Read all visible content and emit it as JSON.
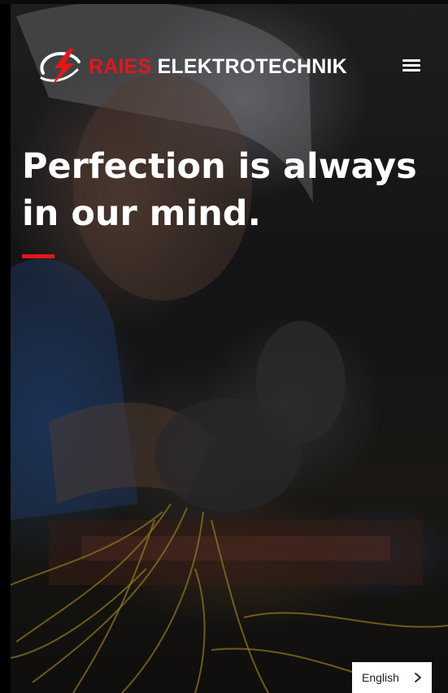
{
  "header": {
    "brand_primary": "RAIES",
    "brand_secondary": "ELEKTROTECHNIK",
    "logo_icon": "lightning-bolt-icon",
    "menu_icon": "hamburger-menu-icon"
  },
  "hero": {
    "title": "Perfection is always in our mind.",
    "background_image": "electrician-wearing-hard-hat-and-safety-glasses-working-on-wires"
  },
  "language_selector": {
    "label": "English",
    "icon": "chevron-right-icon"
  },
  "colors": {
    "accent": "#e4161b",
    "text": "#ffffff",
    "selector_bg": "#ffffff"
  }
}
